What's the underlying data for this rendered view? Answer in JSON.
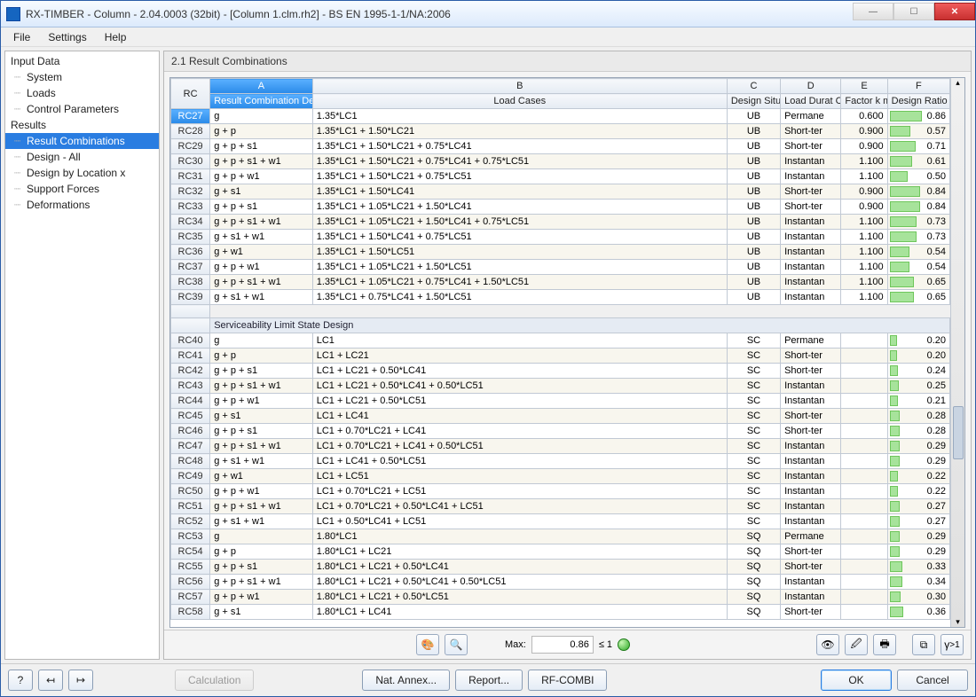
{
  "window": {
    "title": "RX-TIMBER - Column - 2.04.0003 (32bit) - [Column 1.clm.rh2] - BS EN 1995-1-1/NA:2006"
  },
  "menu": [
    "File",
    "Settings",
    "Help"
  ],
  "sidebar": {
    "group1": "Input Data",
    "items1": [
      "System",
      "Loads",
      "Control Parameters"
    ],
    "group2": "Results",
    "items2": [
      "Result Combinations",
      "Design - All",
      "Design by Location x",
      "Support Forces",
      "Deformations"
    ],
    "selected": "Result Combinations"
  },
  "panel": {
    "title": "2.1 Result Combinations"
  },
  "columns": {
    "letters": [
      "A",
      "B",
      "C",
      "D",
      "E",
      "F"
    ],
    "rc": "RC",
    "a": "Result Combination Description",
    "b": "Load Cases",
    "c": "Design Situation",
    "d": "Load Durat Class (LDC",
    "e": "Factor k mod",
    "f": "Design Ratio η max"
  },
  "section_label": "Serviceability Limit State Design",
  "rows": [
    {
      "rc": "RC27",
      "a": "g",
      "b": "1.35*LC1",
      "c": "UB",
      "d": "Permane",
      "e": "0.600",
      "f": 0.86,
      "sel": true
    },
    {
      "rc": "RC28",
      "a": "g + p",
      "b": "1.35*LC1 + 1.50*LC21",
      "c": "UB",
      "d": "Short-ter",
      "e": "0.900",
      "f": 0.57
    },
    {
      "rc": "RC29",
      "a": "g + p + s1",
      "b": "1.35*LC1 + 1.50*LC21 + 0.75*LC41",
      "c": "UB",
      "d": "Short-ter",
      "e": "0.900",
      "f": 0.71
    },
    {
      "rc": "RC30",
      "a": "g + p + s1 + w1",
      "b": "1.35*LC1 + 1.50*LC21 + 0.75*LC41 + 0.75*LC51",
      "c": "UB",
      "d": "Instantan",
      "e": "1.100",
      "f": 0.61
    },
    {
      "rc": "RC31",
      "a": "g + p + w1",
      "b": "1.35*LC1 + 1.50*LC21 + 0.75*LC51",
      "c": "UB",
      "d": "Instantan",
      "e": "1.100",
      "f": 0.5
    },
    {
      "rc": "RC32",
      "a": "g + s1",
      "b": "1.35*LC1 + 1.50*LC41",
      "c": "UB",
      "d": "Short-ter",
      "e": "0.900",
      "f": 0.84
    },
    {
      "rc": "RC33",
      "a": "g + p + s1",
      "b": "1.35*LC1 + 1.05*LC21 + 1.50*LC41",
      "c": "UB",
      "d": "Short-ter",
      "e": "0.900",
      "f": 0.84
    },
    {
      "rc": "RC34",
      "a": "g + p + s1 + w1",
      "b": "1.35*LC1 + 1.05*LC21 + 1.50*LC41 + 0.75*LC51",
      "c": "UB",
      "d": "Instantan",
      "e": "1.100",
      "f": 0.73
    },
    {
      "rc": "RC35",
      "a": "g + s1 + w1",
      "b": "1.35*LC1 + 1.50*LC41 + 0.75*LC51",
      "c": "UB",
      "d": "Instantan",
      "e": "1.100",
      "f": 0.73
    },
    {
      "rc": "RC36",
      "a": "g + w1",
      "b": "1.35*LC1 + 1.50*LC51",
      "c": "UB",
      "d": "Instantan",
      "e": "1.100",
      "f": 0.54
    },
    {
      "rc": "RC37",
      "a": "g + p + w1",
      "b": "1.35*LC1 + 1.05*LC21 + 1.50*LC51",
      "c": "UB",
      "d": "Instantan",
      "e": "1.100",
      "f": 0.54
    },
    {
      "rc": "RC38",
      "a": "g + p + s1 + w1",
      "b": "1.35*LC1 + 1.05*LC21 + 0.75*LC41 + 1.50*LC51",
      "c": "UB",
      "d": "Instantan",
      "e": "1.100",
      "f": 0.65
    },
    {
      "rc": "RC39",
      "a": "g + s1 + w1",
      "b": "1.35*LC1 + 0.75*LC41 + 1.50*LC51",
      "c": "UB",
      "d": "Instantan",
      "e": "1.100",
      "f": 0.65
    }
  ],
  "rows2": [
    {
      "rc": "RC40",
      "a": "g",
      "b": "LC1",
      "c": "SC",
      "d": "Permane",
      "e": "",
      "f": 0.2
    },
    {
      "rc": "RC41",
      "a": "g + p",
      "b": "LC1 + LC21",
      "c": "SC",
      "d": "Short-ter",
      "e": "",
      "f": 0.2
    },
    {
      "rc": "RC42",
      "a": "g + p + s1",
      "b": "LC1 + LC21 + 0.50*LC41",
      "c": "SC",
      "d": "Short-ter",
      "e": "",
      "f": 0.24
    },
    {
      "rc": "RC43",
      "a": "g + p + s1 + w1",
      "b": "LC1 + LC21 + 0.50*LC41 + 0.50*LC51",
      "c": "SC",
      "d": "Instantan",
      "e": "",
      "f": 0.25
    },
    {
      "rc": "RC44",
      "a": "g + p + w1",
      "b": "LC1 + LC21 + 0.50*LC51",
      "c": "SC",
      "d": "Instantan",
      "e": "",
      "f": 0.21
    },
    {
      "rc": "RC45",
      "a": "g + s1",
      "b": "LC1 + LC41",
      "c": "SC",
      "d": "Short-ter",
      "e": "",
      "f": 0.28
    },
    {
      "rc": "RC46",
      "a": "g + p + s1",
      "b": "LC1 + 0.70*LC21 + LC41",
      "c": "SC",
      "d": "Short-ter",
      "e": "",
      "f": 0.28
    },
    {
      "rc": "RC47",
      "a": "g + p + s1 + w1",
      "b": "LC1 + 0.70*LC21 + LC41 + 0.50*LC51",
      "c": "SC",
      "d": "Instantan",
      "e": "",
      "f": 0.29
    },
    {
      "rc": "RC48",
      "a": "g + s1 + w1",
      "b": "LC1 + LC41 + 0.50*LC51",
      "c": "SC",
      "d": "Instantan",
      "e": "",
      "f": 0.29
    },
    {
      "rc": "RC49",
      "a": "g + w1",
      "b": "LC1 + LC51",
      "c": "SC",
      "d": "Instantan",
      "e": "",
      "f": 0.22
    },
    {
      "rc": "RC50",
      "a": "g + p + w1",
      "b": "LC1 + 0.70*LC21 + LC51",
      "c": "SC",
      "d": "Instantan",
      "e": "",
      "f": 0.22
    },
    {
      "rc": "RC51",
      "a": "g + p + s1 + w1",
      "b": "LC1 + 0.70*LC21 + 0.50*LC41 + LC51",
      "c": "SC",
      "d": "Instantan",
      "e": "",
      "f": 0.27
    },
    {
      "rc": "RC52",
      "a": "g + s1 + w1",
      "b": "LC1 + 0.50*LC41 + LC51",
      "c": "SC",
      "d": "Instantan",
      "e": "",
      "f": 0.27
    },
    {
      "rc": "RC53",
      "a": "g",
      "b": "1.80*LC1",
      "c": "SQ",
      "d": "Permane",
      "e": "",
      "f": 0.29
    },
    {
      "rc": "RC54",
      "a": "g + p",
      "b": "1.80*LC1 + LC21",
      "c": "SQ",
      "d": "Short-ter",
      "e": "",
      "f": 0.29
    },
    {
      "rc": "RC55",
      "a": "g + p + s1",
      "b": "1.80*LC1 + LC21 + 0.50*LC41",
      "c": "SQ",
      "d": "Short-ter",
      "e": "",
      "f": 0.33
    },
    {
      "rc": "RC56",
      "a": "g + p + s1 + w1",
      "b": "1.80*LC1 + LC21 + 0.50*LC41 + 0.50*LC51",
      "c": "SQ",
      "d": "Instantan",
      "e": "",
      "f": 0.34
    },
    {
      "rc": "RC57",
      "a": "g + p + w1",
      "b": "1.80*LC1 + LC21 + 0.50*LC51",
      "c": "SQ",
      "d": "Instantan",
      "e": "",
      "f": 0.3
    },
    {
      "rc": "RC58",
      "a": "g + s1",
      "b": "1.80*LC1 + LC41",
      "c": "SQ",
      "d": "Short-ter",
      "e": "",
      "f": 0.36
    }
  ],
  "status": {
    "max_label": "Max:",
    "max_value": "0.86",
    "limit": "≤ 1"
  },
  "footer": {
    "calc": "Calculation",
    "nat": "Nat. Annex...",
    "report": "Report...",
    "combi": "RF-COMBI",
    "ok": "OK",
    "cancel": "Cancel"
  }
}
